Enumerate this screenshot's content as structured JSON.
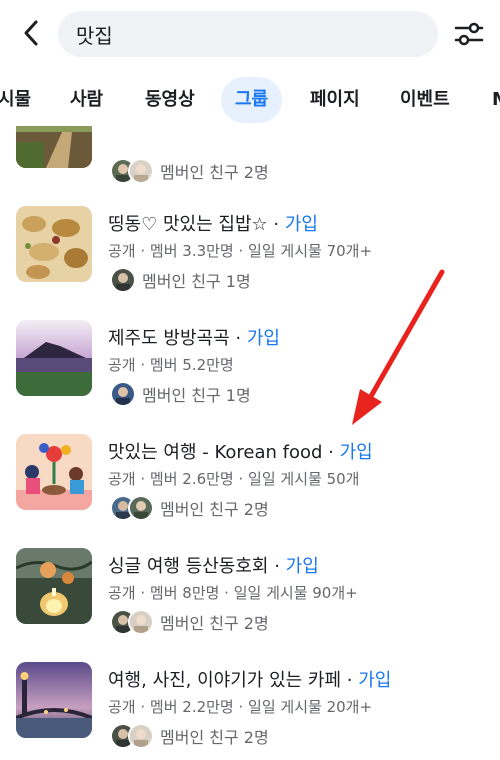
{
  "header": {
    "back_icon": "chevron-left-icon",
    "search_query": "맛집",
    "filter_icon": "sliders-icon"
  },
  "tabs": [
    {
      "label": "게시물",
      "visible_text": "시물",
      "active": false
    },
    {
      "label": "사람",
      "active": false
    },
    {
      "label": "동영상",
      "active": false
    },
    {
      "label": "그룹",
      "active": true
    },
    {
      "label": "페이지",
      "active": false
    },
    {
      "label": "이벤트",
      "active": false
    },
    {
      "label": "M",
      "active": false
    }
  ],
  "results": [
    {
      "title": "",
      "join": "",
      "meta": "",
      "friends": "멤버인 친구 2명"
    },
    {
      "title": "띵동♡ 맛있는 집밥☆",
      "join": "가입",
      "meta": "공개 · 멤버 3.3만명 · 일일 게시물 70개+",
      "friends": "멤버인 친구 1명"
    },
    {
      "title": "제주도 방방곡곡",
      "join": "가입",
      "meta": "공개 · 멤버 5.2만명",
      "friends": "멤버인 친구 1명"
    },
    {
      "title": "맛있는 여행 - Korean food",
      "join": "가입",
      "meta": "공개 · 멤버 2.6만명 · 일일 게시물 50개",
      "friends": "멤버인 친구 2명"
    },
    {
      "title": "싱글 여행 등산동호회",
      "join": "가입",
      "meta": "공개 · 멤버 8만명 · 일일 게시물 90개+",
      "friends": "멤버인 친구 2명"
    },
    {
      "title": "여행, 사진, 이야기가 있는 카페",
      "join": "가입",
      "meta": "공개 · 멤버 2.2만명 · 일일 게시물 20개+",
      "friends": "멤버인 친구 2명"
    }
  ],
  "separator": " · ",
  "colors": {
    "accent": "#1877f2",
    "annotation_arrow": "#e8231e",
    "muted_text": "#65676b",
    "search_bg": "#f0f2f5"
  }
}
